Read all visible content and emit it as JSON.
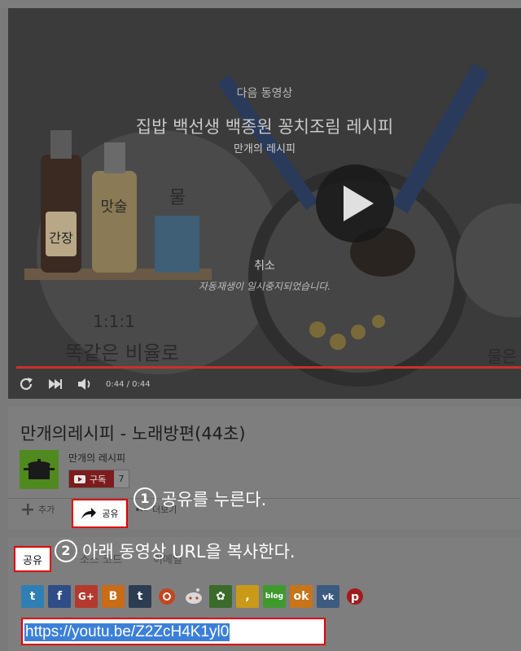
{
  "player": {
    "next_label": "다음 동영상",
    "next_title": "집밥 백선생 백종원 꽁치조림 레시피",
    "next_channel": "만개의 레시피",
    "cancel_label": "취소",
    "autoplay_paused": "자동재생이 일시중지되었습니다.",
    "time": "0:44 / 0:44",
    "progress": 1.0,
    "art_text": {
      "soy_label": "간장",
      "cooking_wine": "맛술",
      "water": "물",
      "ratio": "1:1:1",
      "same_ratio": "똑같은 비율로",
      "right_cut": "물은"
    }
  },
  "video": {
    "title": "만개의레시피 - 노래방편(44초)",
    "channel": "만개의 레시피",
    "subscribe_label": "구독",
    "subscriber_count": "7"
  },
  "actions": {
    "add_label": "추가",
    "share_label": "공유",
    "more_label": "더보기"
  },
  "callouts": {
    "step1_num": "1",
    "step1_text": "공유를 누른다.",
    "step2_num": "2",
    "step2_text": "아래 동영상 URL을 복사한다."
  },
  "share_panel": {
    "tab_share": "공유",
    "tab_embed": "소스 코드",
    "tab_email": "이메일",
    "url": "https://youtu.be/Z2ZcH4K1yl0",
    "social_icons": [
      "twitter-icon",
      "facebook-icon",
      "google-plus-icon",
      "blogger-icon",
      "tumblr-icon",
      "stumbleupon-icon",
      "reddit-icon",
      "cyworld-icon",
      "kakao-story-icon",
      "naver-blog-icon",
      "odnoklassniki-icon",
      "vk-icon",
      "pinterest-icon"
    ]
  },
  "colors": {
    "accent_red": "#e00000",
    "progress_red": "#c9302c",
    "selection_blue": "#3b80d8",
    "youtube_dark_red": "#7c1c1c"
  }
}
